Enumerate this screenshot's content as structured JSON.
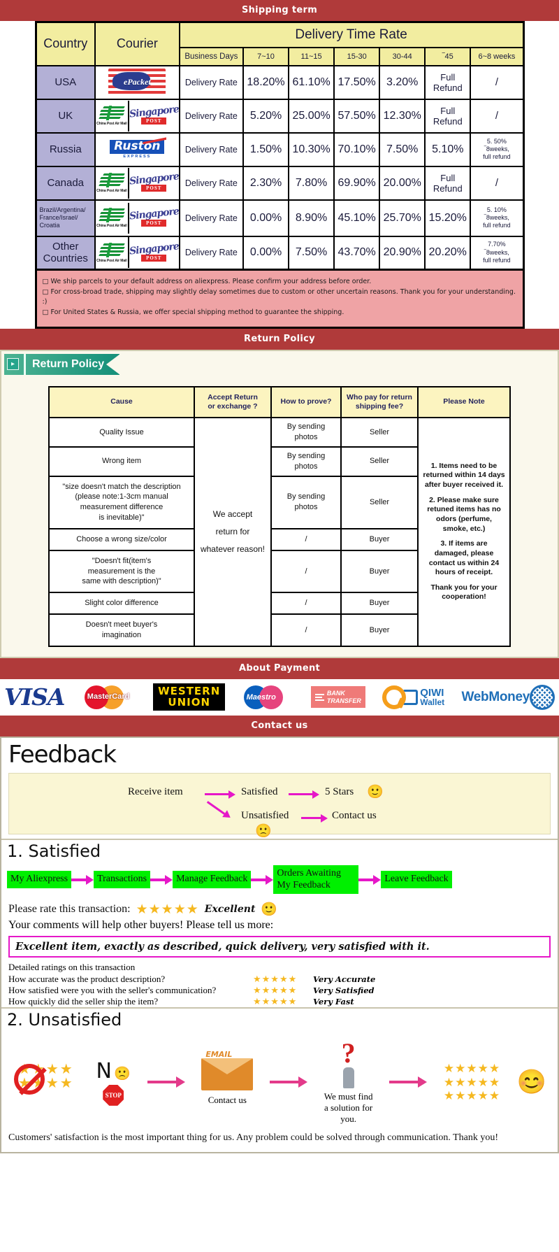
{
  "banners": {
    "shipping": "Shipping term",
    "return": "Return Policy",
    "payment": "About Payment",
    "contact": "Contact us"
  },
  "shipping": {
    "headers": {
      "country": "Country",
      "courier": "Courier",
      "delivery_time_rate": "Delivery Time Rate",
      "business_days": "Business Days",
      "ranges": [
        "7~10",
        "11~15",
        "15-30",
        "30-44",
        "‾45",
        "6~8 weeks"
      ]
    },
    "rows": [
      {
        "country": "USA",
        "couriers": [
          "epacket"
        ],
        "rate_label": "Delivery Rate",
        "values": [
          "18.20%",
          "61.10%",
          "17.50%",
          "3.20%",
          "Full Refund",
          "/"
        ]
      },
      {
        "country": "UK",
        "couriers": [
          "china-post",
          "singapore-post"
        ],
        "rate_label": "Delivery Rate",
        "values": [
          "5.20%",
          "25.00%",
          "57.50%",
          "12.30%",
          "Full Refund",
          "/"
        ]
      },
      {
        "country": "Russia",
        "couriers": [
          "ruston"
        ],
        "rate_label": "Delivery Rate",
        "values": [
          "1.50%",
          "10.30%",
          "70.10%",
          "7.50%",
          "5.10%",
          "5. 50%\n‾8weeks,\nfull refund"
        ]
      },
      {
        "country": "Canada",
        "couriers": [
          "china-post",
          "singapore-post"
        ],
        "rate_label": "Delivery Rate",
        "values": [
          "2.30%",
          "7.80%",
          "69.90%",
          "20.00%",
          "Full Refund",
          "/"
        ]
      },
      {
        "country": "Brazil/Argentina/\nFrance/Israel/\nCroatia",
        "couriers": [
          "china-post",
          "singapore-post"
        ],
        "rate_label": "Delivery Rate",
        "values": [
          "0.00%",
          "8.90%",
          "45.10%",
          "25.70%",
          "15.20%",
          "5. 10%\n‾8weeks,\nfull refund"
        ]
      },
      {
        "country": "Other Countries",
        "couriers": [
          "china-post",
          "singapore-post"
        ],
        "rate_label": "Delivery Rate",
        "values": [
          "0.00%",
          "7.50%",
          "43.70%",
          "20.90%",
          "20.20%",
          "7.70%\n‾8weeks,\nfull refund"
        ]
      }
    ],
    "notes": [
      "We ship parcels to your default address on aliexpress. Please confirm your address before order.",
      "For cross-broad trade, shipping may slightly delay sometimes due to custom or other uncertain reasons. Thank you for your understanding. :)",
      "For United States & Russia, we offer special shipping method to guarantee the shipping."
    ]
  },
  "return_policy": {
    "tab_label": "Return Policy",
    "headers": [
      "Cause",
      "Accept Return\nor exchange ?",
      "How to prove?",
      "Who pay for return\nshipping fee?",
      "Please Note"
    ],
    "accept_text": "We accept\nreturn for\nwhatever reason!",
    "rows": [
      {
        "cause": "Quality Issue",
        "prove": "By sending\nphotos",
        "who_pays": "Seller"
      },
      {
        "cause": "Wrong item",
        "prove": "By sending\nphotos",
        "who_pays": "Seller"
      },
      {
        "cause": "\"size doesn't match the description\n(please note:1-3cm manual\nmeasurement difference\nis inevitable)\"",
        "prove": "By sending\nphotos",
        "who_pays": "Seller"
      },
      {
        "cause": "Choose a wrong size/color",
        "prove": "/",
        "who_pays": "Buyer"
      },
      {
        "cause": "\"Doesn't fit(item's\nmeasurement is the\nsame with description)\"",
        "prove": "/",
        "who_pays": "Buyer"
      },
      {
        "cause": "Slight color difference",
        "prove": "/",
        "who_pays": "Buyer"
      },
      {
        "cause": "Doesn't meet buyer's\nimagination",
        "prove": "/",
        "who_pays": "Buyer"
      }
    ],
    "notes": [
      "1. Items need to be returned within 14 days after buyer received it.",
      "2. Please make sure retuned items has no odors (perfume, smoke, etc.)",
      "3. If items are damaged, please contact us within 24 hours of receipt.",
      "Thank you for your cooperation!"
    ]
  },
  "payment": {
    "methods": [
      {
        "name": "visa",
        "label": "VISA"
      },
      {
        "name": "mastercard",
        "label": "MasterCard"
      },
      {
        "name": "western-union",
        "label_line1": "WESTERN",
        "label_line2": "UNION"
      },
      {
        "name": "maestro",
        "label": "Maestro"
      },
      {
        "name": "bank-transfer",
        "label_line1": "BANK",
        "label_line2": "TRANSFER"
      },
      {
        "name": "qiwi-wallet",
        "label_line1": "QIWI",
        "label_line2": "Wallet"
      },
      {
        "name": "webmoney",
        "label": "WebMoney"
      }
    ]
  },
  "feedback": {
    "title": "Feedback",
    "flow": {
      "receive_item": "Receive item",
      "satisfied": "Satisfied",
      "five_stars": "5 Stars",
      "unsatisfied": "Unsatisfied",
      "contact_us": "Contact us",
      "happy_face": "🙂",
      "sad_face": "☹"
    },
    "satisfied": {
      "heading": "1. Satisfied",
      "steps": [
        "My Aliexpress",
        "Transactions",
        "Manage Feedback",
        "Orders Awaiting\nMy Feedback",
        "Leave Feedback"
      ],
      "rate_label": "Please rate this transaction:",
      "stars": "★★★★★",
      "rating_word": "Excellent",
      "tell_more": "Your comments will help other buyers! Please tell us more:",
      "sample_comment": "Excellent item, exactly as described, quick delivery, very satisfied with it.",
      "detailed_heading": "Detailed ratings on this transaction",
      "detailed": [
        {
          "question": "How accurate was the product description?",
          "stars": "★★★★★",
          "value": "Very Accurate"
        },
        {
          "question": "How satisfied were you with the seller's communication?",
          "stars": "★★★★★",
          "value": "Very Satisfied"
        },
        {
          "question": "How quickly did the seller ship the item?",
          "stars": "★★★★★",
          "value": "Very Fast"
        }
      ]
    },
    "unsatisfied": {
      "heading": "2. Unsatisfied",
      "no_stars_label": "N",
      "stop_label": "STOP",
      "email_label": "EMAIL",
      "contact_us": "Contact us",
      "solution_text": "We must find\na solution for\nyou.",
      "good_stars": "★★★★★",
      "closing": "Customers' satisfaction is the most important thing for us. Any problem could be solved through communication. Thank you!"
    }
  }
}
